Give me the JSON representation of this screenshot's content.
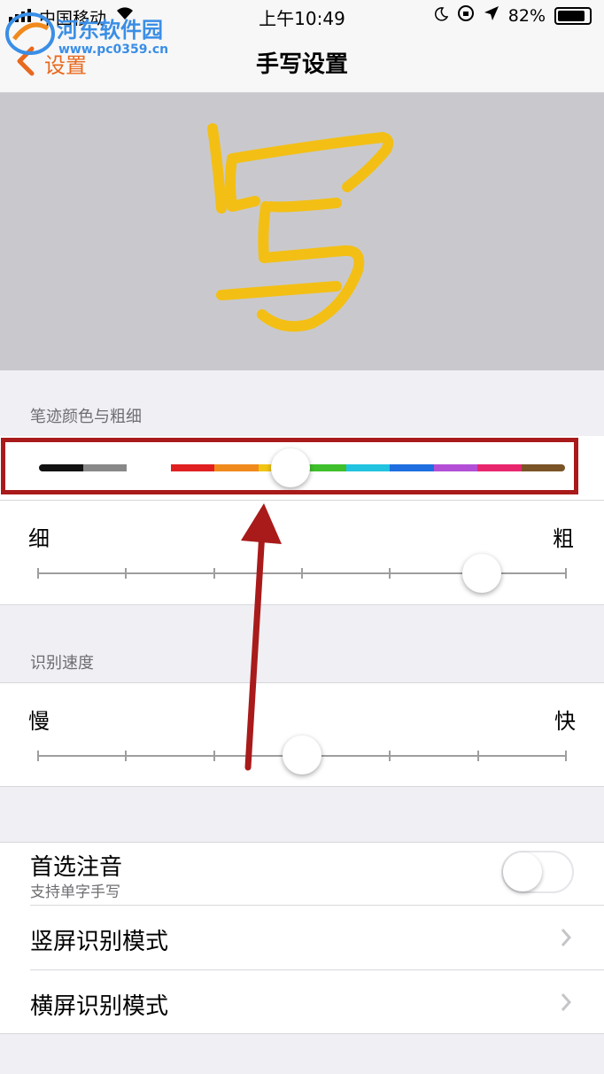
{
  "status_bar": {
    "carrier": "中国移动",
    "time": "上午10:49",
    "battery": "82%"
  },
  "nav": {
    "back_label": "设置",
    "title": "手写设置"
  },
  "watermark": {
    "name": "河东软件园",
    "url": "www.pc0359.cn"
  },
  "sections": {
    "stroke_header": "笔迹颜色与粗细",
    "speed_header": "识别速度"
  },
  "colors": [
    "#111111",
    "#888888",
    "#ffffff",
    "#e02020",
    "#f08a1d",
    "#f2c414",
    "#3fbf2c",
    "#22c3e0",
    "#1f6fe0",
    "#b34fd6",
    "#e8266e",
    "#7a5427"
  ],
  "selected_color_index": 5,
  "thickness": {
    "thin_label": "细",
    "thick_label": "粗",
    "level": 0.84
  },
  "speed": {
    "slow_label": "慢",
    "fast_label": "快",
    "level": 0.5
  },
  "rows": [
    {
      "title": "首选注音",
      "subtitle": "支持单字手写",
      "type": "toggle",
      "on": false
    },
    {
      "title": "竖屏识别模式",
      "type": "disclosure"
    },
    {
      "title": "横屏识别模式",
      "type": "disclosure"
    }
  ],
  "ink_color": "#f3bf14"
}
